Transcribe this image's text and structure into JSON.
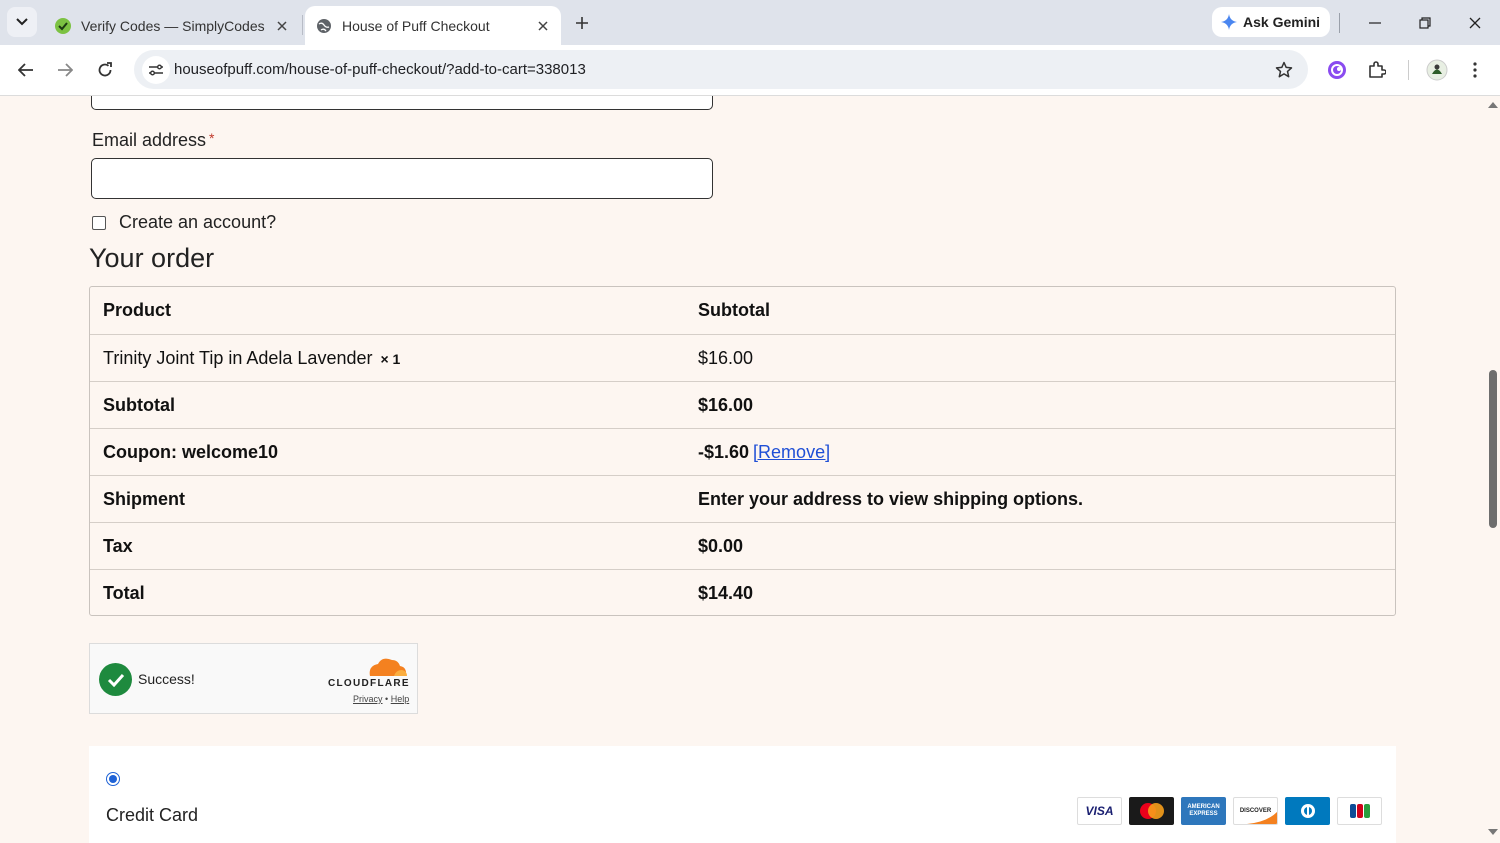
{
  "browser": {
    "tabs": [
      {
        "title": "Verify Codes — SimplyCodes",
        "active": false
      },
      {
        "title": "House of Puff Checkout",
        "active": true
      }
    ],
    "gemini_label": "Ask Gemini",
    "url": "houseofpuff.com/house-of-puff-checkout/?add-to-cart=338013"
  },
  "form": {
    "email_label": "Email address",
    "required_mark": "*",
    "email_value": "",
    "create_account_label": "Create an account?"
  },
  "order": {
    "heading": "Your order",
    "header": {
      "product": "Product",
      "subtotal": "Subtotal"
    },
    "item": {
      "name": "Trinity Joint Tip in Adela Lavender",
      "qty": "× 1",
      "price": "$16.00"
    },
    "subtotal": {
      "label": "Subtotal",
      "value": "$16.00"
    },
    "coupon": {
      "label": "Coupon: welcome10",
      "value": "-$1.60",
      "remove": "[Remove]"
    },
    "shipment": {
      "label": "Shipment",
      "value": "Enter your address to view shipping options."
    },
    "tax": {
      "label": "Tax",
      "value": "$0.00"
    },
    "total": {
      "label": "Total",
      "value": "$14.40"
    }
  },
  "captcha": {
    "status": "Success!",
    "brand": "CLOUDFLARE",
    "privacy": "Privacy",
    "separator": "•",
    "help": "Help"
  },
  "payment": {
    "method_label": "Credit Card",
    "selected": true,
    "card_brands": [
      "visa",
      "mastercard",
      "american-express",
      "discover",
      "diners-club",
      "jcb"
    ]
  },
  "colors": {
    "page_bg": "#fdf6f1",
    "link": "#1f4fd6",
    "success": "#1e8a3e",
    "radio": "#1f63d6"
  }
}
